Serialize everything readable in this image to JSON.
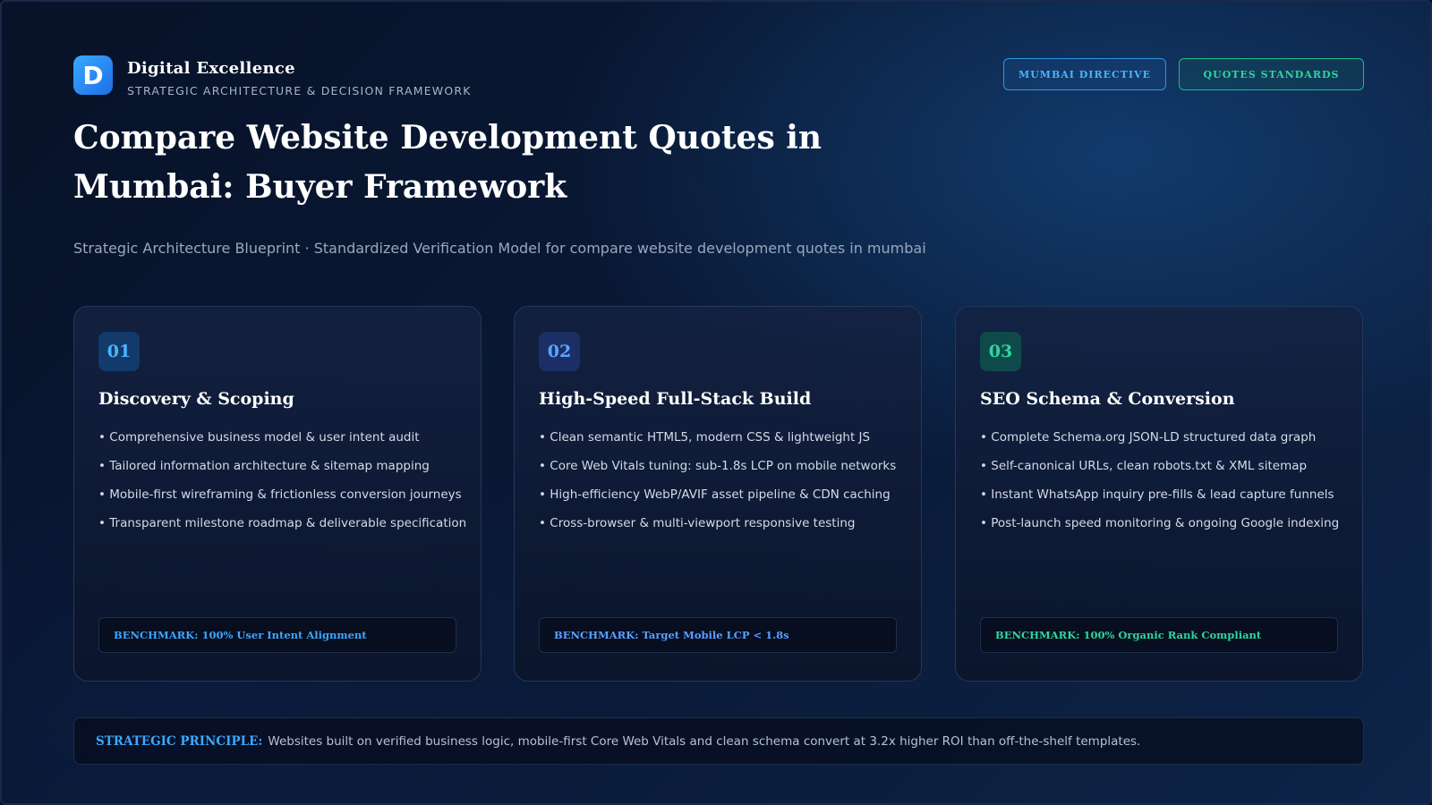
{
  "header": {
    "logo_letter": "D",
    "brand_title": "Digital Excellence",
    "brand_subtitle": "STRATEGIC ARCHITECTURE & DECISION FRAMEWORK",
    "tags": [
      {
        "label": "MUMBAI DIRECTIVE",
        "color": "#4db2ff"
      },
      {
        "label": "QUOTES STANDARDS",
        "color": "#2fd69d"
      }
    ]
  },
  "hero": {
    "title": "Compare Website Development Quotes in Mumbai: Buyer Framework",
    "subtitle": "Strategic Architecture Blueprint · Standardized Verification Model for compare website development quotes in mumbai"
  },
  "cards": [
    {
      "number": "01",
      "title": "Discovery & Scoping",
      "accent": "#3aa8ff",
      "bullets": [
        "Comprehensive business model & user intent audit",
        "Tailored information architecture & sitemap mapping",
        "Mobile-first wireframing & frictionless conversion journeys",
        "Transparent milestone roadmap & deliverable specification"
      ],
      "benchmark": "BENCHMARK: 100% User Intent Alignment"
    },
    {
      "number": "02",
      "title": "High-Speed Full-Stack Build",
      "accent": "#5aa0ff",
      "bullets": [
        "Clean semantic HTML5, modern CSS & lightweight JS",
        "Core Web Vitals tuning: sub-1.8s LCP on mobile networks",
        "High-efficiency WebP/AVIF asset pipeline & CDN caching",
        "Cross-browser & multi-viewport responsive testing"
      ],
      "benchmark": "BENCHMARK: Target Mobile LCP < 1.8s"
    },
    {
      "number": "03",
      "title": "SEO Schema & Conversion",
      "accent": "#2fd69d",
      "bullets": [
        "Complete Schema.org JSON-LD structured data graph",
        "Self-canonical URLs, clean robots.txt & XML sitemap",
        "Instant WhatsApp inquiry pre-fills & lead capture funnels",
        "Post-launch speed monitoring & ongoing Google indexing"
      ],
      "benchmark": "BENCHMARK: 100% Organic Rank Compliant"
    }
  ],
  "principle": {
    "label": "STRATEGIC PRINCIPLE:",
    "text": "Websites built on verified business logic, mobile-first Core Web Vitals and clean schema convert at 3.2x higher ROI than off-the-shelf templates."
  }
}
